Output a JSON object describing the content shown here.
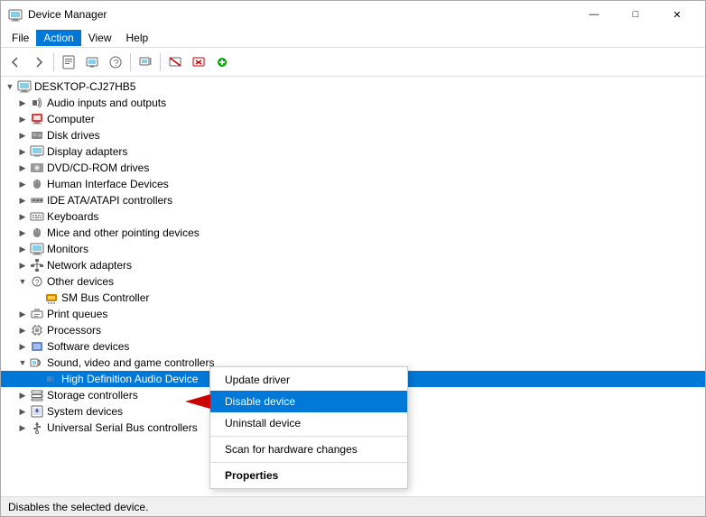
{
  "window": {
    "title": "Device Manager",
    "title_icon": "🖥",
    "controls": {
      "minimize": "—",
      "maximize": "□",
      "close": "✕"
    }
  },
  "menu": {
    "items": [
      "File",
      "Action",
      "View",
      "Help"
    ]
  },
  "toolbar": {
    "buttons": [
      "←",
      "→",
      "⊞",
      "⊟",
      "?",
      "⊟",
      "🖥",
      "✕",
      "⬇"
    ]
  },
  "tree": {
    "root": {
      "label": "DESKTOP-CJ27HB5",
      "expanded": true
    },
    "items": [
      {
        "label": "Audio inputs and outputs",
        "indent": 1,
        "expanded": false,
        "icon": "audio"
      },
      {
        "label": "Computer",
        "indent": 1,
        "expanded": false,
        "icon": "computer"
      },
      {
        "label": "Disk drives",
        "indent": 1,
        "expanded": false,
        "icon": "disk"
      },
      {
        "label": "Display adapters",
        "indent": 1,
        "expanded": false,
        "icon": "display"
      },
      {
        "label": "DVD/CD-ROM drives",
        "indent": 1,
        "expanded": false,
        "icon": "dvd"
      },
      {
        "label": "Human Interface Devices",
        "indent": 1,
        "expanded": false,
        "icon": "hid"
      },
      {
        "label": "IDE ATA/ATAPI controllers",
        "indent": 1,
        "expanded": false,
        "icon": "ide"
      },
      {
        "label": "Keyboards",
        "indent": 1,
        "expanded": false,
        "icon": "keyboard"
      },
      {
        "label": "Mice and other pointing devices",
        "indent": 1,
        "expanded": false,
        "icon": "mouse"
      },
      {
        "label": "Monitors",
        "indent": 1,
        "expanded": false,
        "icon": "monitor"
      },
      {
        "label": "Network adapters",
        "indent": 1,
        "expanded": false,
        "icon": "network"
      },
      {
        "label": "Other devices",
        "indent": 1,
        "expanded": true,
        "icon": "other"
      },
      {
        "label": "SM Bus Controller",
        "indent": 2,
        "expanded": false,
        "icon": "unknown"
      },
      {
        "label": "Print queues",
        "indent": 1,
        "expanded": false,
        "icon": "print"
      },
      {
        "label": "Processors",
        "indent": 1,
        "expanded": false,
        "icon": "processor"
      },
      {
        "label": "Software devices",
        "indent": 1,
        "expanded": false,
        "icon": "software"
      },
      {
        "label": "Sound, video and game controllers",
        "indent": 1,
        "expanded": true,
        "icon": "sound"
      },
      {
        "label": "High Definition Audio Device",
        "indent": 2,
        "expanded": false,
        "icon": "audio_device",
        "selected": true
      },
      {
        "label": "Storage controllers",
        "indent": 1,
        "expanded": false,
        "icon": "storage"
      },
      {
        "label": "System devices",
        "indent": 1,
        "expanded": false,
        "icon": "system"
      },
      {
        "label": "Universal Serial Bus controllers",
        "indent": 1,
        "expanded": false,
        "icon": "usb"
      }
    ]
  },
  "context_menu": {
    "items": [
      {
        "label": "Update driver",
        "type": "normal"
      },
      {
        "label": "Disable device",
        "type": "normal",
        "highlighted": true
      },
      {
        "label": "Uninstall device",
        "type": "normal"
      },
      {
        "label": "",
        "type": "separator"
      },
      {
        "label": "Scan for hardware changes",
        "type": "normal"
      },
      {
        "label": "",
        "type": "separator"
      },
      {
        "label": "Properties",
        "type": "bold"
      }
    ]
  },
  "status_bar": {
    "text": "Disables the selected device."
  }
}
